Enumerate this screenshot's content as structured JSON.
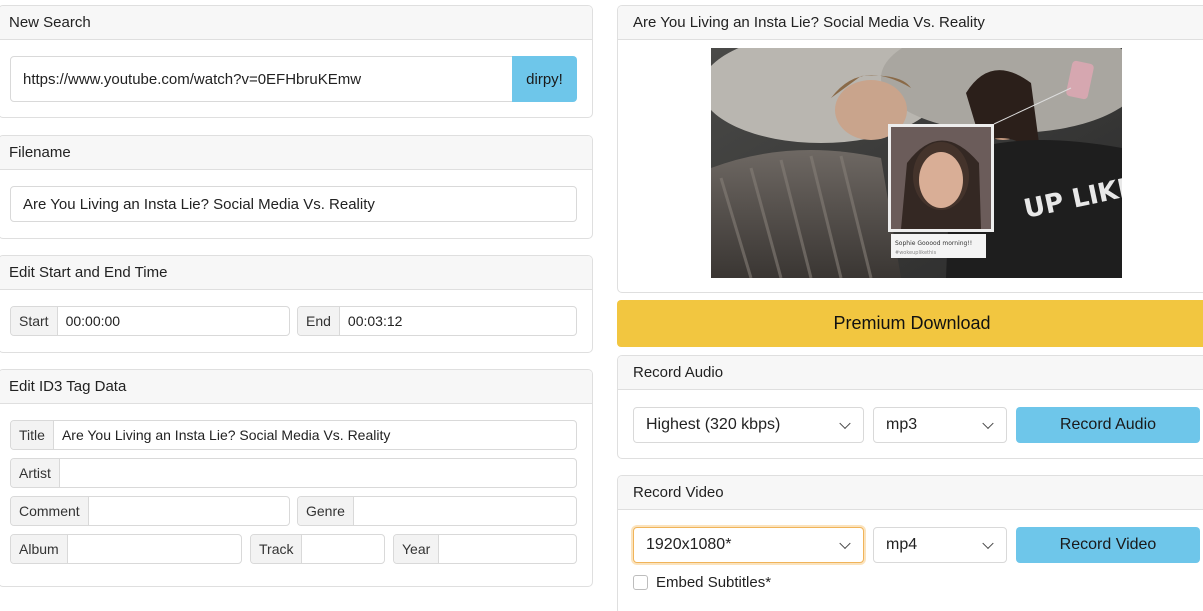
{
  "new_search": {
    "header": "New Search",
    "url_value": "https://www.youtube.com/watch?v=0EFHbruKEmw",
    "go_button": "dirpy!"
  },
  "filename": {
    "header": "Filename",
    "value": "Are You Living an Insta Lie? Social Media Vs. Reality"
  },
  "time": {
    "header": "Edit Start and End Time",
    "start_label": "Start",
    "start_value": "00:00:00",
    "end_label": "End",
    "end_value": "00:03:12"
  },
  "id3": {
    "header": "Edit ID3 Tag Data",
    "title_label": "Title",
    "title_value": "Are You Living an Insta Lie? Social Media Vs. Reality",
    "artist_label": "Artist",
    "artist_value": "",
    "comment_label": "Comment",
    "comment_value": "",
    "genre_label": "Genre",
    "genre_value": "",
    "album_label": "Album",
    "album_value": "",
    "track_label": "Track",
    "track_value": "",
    "year_label": "Year",
    "year_value": ""
  },
  "video": {
    "title": "Are You Living an Insta Lie? Social Media Vs. Reality",
    "thumb_caption_name": "Sophie Gooood morning!!",
    "thumb_caption_tag": "#wokeuplikethis",
    "shirt_text": "UP LIKE THIS"
  },
  "premium": {
    "label": "Premium Download"
  },
  "record_audio": {
    "header": "Record Audio",
    "quality": "Highest (320 kbps)",
    "format": "mp3",
    "button": "Record Audio"
  },
  "record_video": {
    "header": "Record Video",
    "resolution": "1920x1080*",
    "format": "mp4",
    "button": "Record Video",
    "subtitles_label": "Embed Subtitles*"
  },
  "colors": {
    "accent_blue": "#6ec6ea",
    "premium_yellow": "#f2c640",
    "focus_orange": "#f0b45a"
  }
}
